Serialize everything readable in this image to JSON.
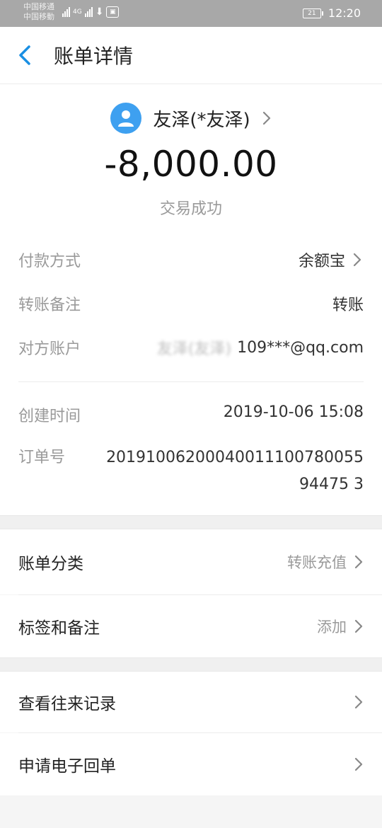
{
  "status_bar": {
    "carrier_1": "中国移通",
    "carrier_2": "中国移動",
    "network_type": "4G",
    "battery_level": "21",
    "time": "12:20"
  },
  "header": {
    "title": "账单详情"
  },
  "summary": {
    "payee_name": "友泽(*友泽)",
    "amount": "-8,000.00",
    "status": "交易成功"
  },
  "details": {
    "payment_method_label": "付款方式",
    "payment_method_value": "余额宝",
    "transfer_note_label": "转账备注",
    "transfer_note_value": "转账",
    "counterparty_label": "对方账户",
    "counterparty_name_blurred": "友泽(友泽)",
    "counterparty_account": "109***@qq.com",
    "created_time_label": "创建时间",
    "created_time_value": "2019-10-06 15:08",
    "order_no_label": "订单号",
    "order_no_value": "2019100620004001110078005594475 3"
  },
  "menu": {
    "bill_category_label": "账单分类",
    "bill_category_value": "转账充值",
    "tags_label": "标签和备注",
    "tags_value": "添加",
    "history_label": "查看往来记录",
    "e_receipt_label": "申请电子回单"
  }
}
